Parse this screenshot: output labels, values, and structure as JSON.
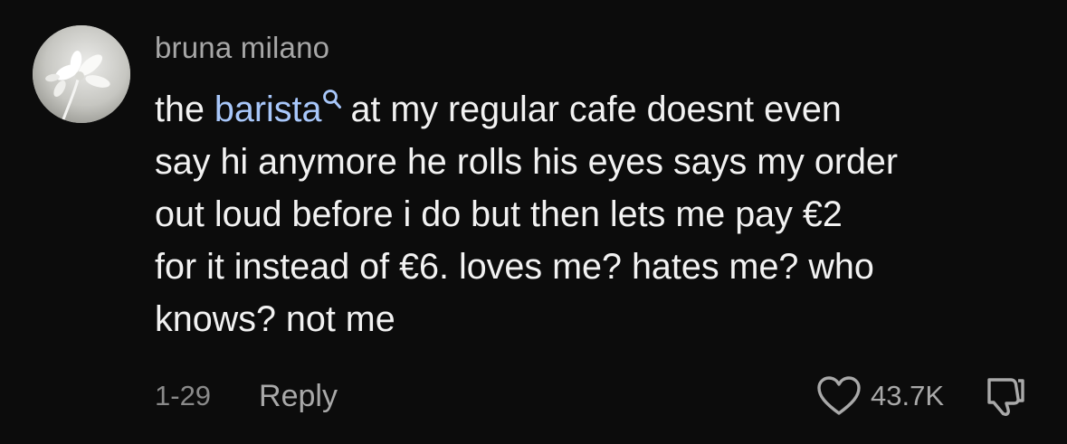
{
  "comment": {
    "author": "bruna milano",
    "text_lines": {
      "line1_keyword": "barista",
      "line1_before": "the ",
      "line1_after": "at my regular cafe doesnt even",
      "line2": "say hi anymore he rolls his eyes says my order",
      "line3": "out loud before i do but then lets me pay €2",
      "line4": "for it instead of €6. loves me? hates me? who",
      "line5": "knows? not me"
    },
    "date": "1-29",
    "reply_label": "Reply",
    "like_count": "43.7K"
  },
  "icons": {
    "avatar": "flower-avatar",
    "keyword_search": "search-icon",
    "like": "heart-outline-icon",
    "dislike": "thumbs-down-icon"
  },
  "colors": {
    "background": "#0c0c0c",
    "text": "#f2f2f2",
    "secondary_text": "#a9a9a9",
    "keyword": "#a8c7fa"
  }
}
